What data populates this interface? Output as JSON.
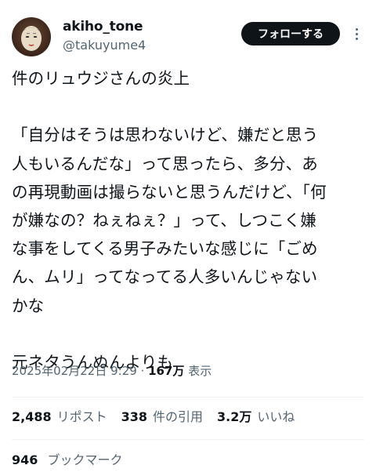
{
  "author": {
    "display_name": "akiho_tone",
    "handle": "@takuyume4",
    "avatar_icon": "noh-mask-avatar"
  },
  "follow_button_label": "フォローする",
  "more_icon": "more-vertical-icon",
  "post": {
    "text": "件のリュウジさんの炎上\n\n「自分はそうは思わないけど、嫌だと思う\n人もいるんだな」って思ったら、多分、あ\nの再現動画は撮らないと思うんだけど、「何\nが嫌なの？ねぇねぇ？」って、しつこく嫌\nな事をしてくる男子みたいな感じに「ごめ\nん、ムリ」ってなってる人多いんじゃない\nかな\n\n元ネタうんぬんよりも",
    "timestamp": "2025年02月22日 9:29",
    "separator": " · ",
    "views_count": "167万",
    "views_label": "表示"
  },
  "stats": {
    "reposts_count": "2,488",
    "reposts_label": "リポスト",
    "quotes_count": "338",
    "quotes_label": "件の引用",
    "likes_count": "3.2万",
    "likes_label": "いいね",
    "bookmarks_count": "946",
    "bookmarks_label": "ブックマーク"
  },
  "colors": {
    "text": "#0f1419",
    "secondary": "#536471",
    "button_bg": "#0f1419",
    "divider": "#eff3f4"
  }
}
